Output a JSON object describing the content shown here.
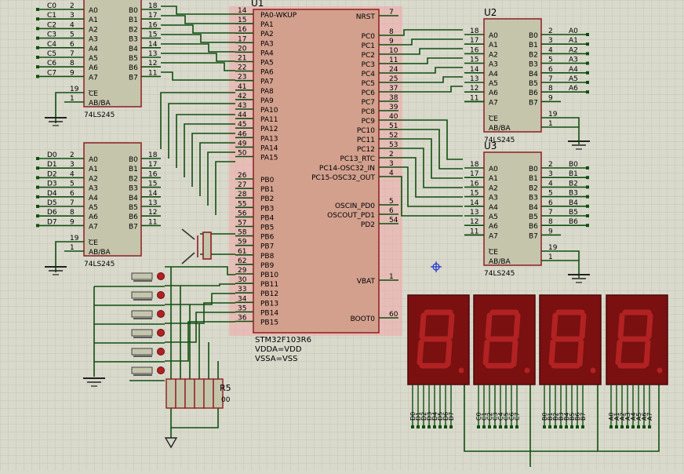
{
  "u1": {
    "ref": "U1",
    "part": "STM32F103R6",
    "props": [
      "VDDA=VDD",
      "VSSA=VSS"
    ],
    "left_pins": [
      {
        "num": "14",
        "name": "PA0-WKUP"
      },
      {
        "num": "15",
        "name": "PA1"
      },
      {
        "num": "16",
        "name": "PA2"
      },
      {
        "num": "17",
        "name": "PA3"
      },
      {
        "num": "20",
        "name": "PA4"
      },
      {
        "num": "21",
        "name": "PA5"
      },
      {
        "num": "22",
        "name": "PA6"
      },
      {
        "num": "23",
        "name": "PA7"
      },
      {
        "num": "41",
        "name": "PA8"
      },
      {
        "num": "42",
        "name": "PA9"
      },
      {
        "num": "43",
        "name": "PA10"
      },
      {
        "num": "44",
        "name": "PA11"
      },
      {
        "num": "45",
        "name": "PA12"
      },
      {
        "num": "46",
        "name": "PA13"
      },
      {
        "num": "49",
        "name": "PA14"
      },
      {
        "num": "50",
        "name": "PA15"
      },
      {
        "num": "26",
        "name": "PB0"
      },
      {
        "num": "27",
        "name": "PB1"
      },
      {
        "num": "28",
        "name": "PB2"
      },
      {
        "num": "55",
        "name": "PB3"
      },
      {
        "num": "56",
        "name": "PB4"
      },
      {
        "num": "57",
        "name": "PB5"
      },
      {
        "num": "58",
        "name": "PB6"
      },
      {
        "num": "59",
        "name": "PB7"
      },
      {
        "num": "61",
        "name": "PB8"
      },
      {
        "num": "62",
        "name": "PB9"
      },
      {
        "num": "29",
        "name": "PB10"
      },
      {
        "num": "30",
        "name": "PB11"
      },
      {
        "num": "33",
        "name": "PB12"
      },
      {
        "num": "34",
        "name": "PB13"
      },
      {
        "num": "35",
        "name": "PB14"
      },
      {
        "num": "36",
        "name": "PB15"
      }
    ],
    "right_pins": [
      {
        "num": "7",
        "name": "NRST"
      },
      {
        "num": "8",
        "name": "PC0"
      },
      {
        "num": "9",
        "name": "PC1"
      },
      {
        "num": "10",
        "name": "PC2"
      },
      {
        "num": "11",
        "name": "PC3"
      },
      {
        "num": "24",
        "name": "PC4"
      },
      {
        "num": "25",
        "name": "PC5"
      },
      {
        "num": "37",
        "name": "PC6"
      },
      {
        "num": "38",
        "name": "PC7"
      },
      {
        "num": "39",
        "name": "PC8"
      },
      {
        "num": "40",
        "name": "PC9"
      },
      {
        "num": "51",
        "name": "PC10"
      },
      {
        "num": "52",
        "name": "PC11"
      },
      {
        "num": "53",
        "name": "PC12"
      },
      {
        "num": "2",
        "name": "PC13_RTC"
      },
      {
        "num": "3",
        "name": "PC14-OSC32_IN"
      },
      {
        "num": "4",
        "name": "PC15-OSC32_OUT"
      },
      {
        "num": "5",
        "name": "OSCIN_PD0"
      },
      {
        "num": "6",
        "name": "OSCOUT_PD1"
      },
      {
        "num": "54",
        "name": "PD2"
      },
      {
        "num": "1",
        "name": "VBAT"
      },
      {
        "num": "60",
        "name": "BOOT0"
      }
    ]
  },
  "buffers": [
    {
      "ref": "",
      "part": "74LS245",
      "nets": [
        "C0",
        "C1",
        "C2",
        "C3",
        "C4",
        "C5",
        "C6",
        "C7"
      ],
      "left_nums": [
        "2",
        "3",
        "4",
        "5",
        "6",
        "7",
        "8",
        "9"
      ],
      "right_nums": [
        "18",
        "17",
        "16",
        "15",
        "14",
        "13",
        "12",
        "11"
      ],
      "a_labels": [
        "A0",
        "A1",
        "A2",
        "A3",
        "A4",
        "A5",
        "A6",
        "A7"
      ],
      "b_labels": [
        "B0",
        "B1",
        "B2",
        "B3",
        "B4",
        "B5",
        "B6",
        "B7"
      ],
      "ce_num": "19",
      "dir_num": "1",
      "ce_label": "CE",
      "dir_label": "AB/BA"
    },
    {
      "ref": "",
      "part": "74LS245",
      "nets": [
        "D0",
        "D1",
        "D2",
        "D3",
        "D4",
        "D5",
        "D6",
        "D7"
      ],
      "left_nums": [
        "2",
        "3",
        "4",
        "5",
        "6",
        "7",
        "8",
        "9"
      ],
      "right_nums": [
        "18",
        "17",
        "16",
        "15",
        "14",
        "13",
        "12",
        "11"
      ],
      "a_labels": [
        "A0",
        "A1",
        "A2",
        "A3",
        "A4",
        "A5",
        "A6",
        "A7"
      ],
      "b_labels": [
        "B0",
        "B1",
        "B2",
        "B3",
        "B4",
        "B5",
        "B6",
        "B7"
      ],
      "ce_num": "19",
      "dir_num": "1",
      "ce_label": "CE",
      "dir_label": "AB/BA"
    },
    {
      "ref": "U2",
      "part": "74LS245",
      "nets": [
        "A0",
        "A1",
        "A2",
        "A3",
        "A4",
        "A5",
        "A6"
      ],
      "left_nums": [
        "18",
        "17",
        "16",
        "15",
        "14",
        "13",
        "12",
        "11"
      ],
      "right_nums": [
        "2",
        "3",
        "4",
        "5",
        "6",
        "7",
        "8",
        "9"
      ],
      "a_labels": [
        "A0",
        "A1",
        "A2",
        "A3",
        "A4",
        "A5",
        "A6",
        "A7"
      ],
      "b_labels": [
        "B0",
        "B1",
        "B2",
        "B3",
        "B4",
        "B5",
        "B6",
        "B7"
      ],
      "ce_num": "19",
      "dir_num": "1",
      "ce_label": "CE",
      "dir_label": "AB/BA"
    },
    {
      "ref": "U3",
      "part": "74LS245",
      "nets": [
        "B0",
        "B1",
        "B2",
        "B3",
        "B4",
        "B5",
        "B6"
      ],
      "left_nums": [
        "18",
        "17",
        "16",
        "15",
        "14",
        "13",
        "12",
        "11"
      ],
      "right_nums": [
        "2",
        "3",
        "4",
        "5",
        "6",
        "7",
        "8",
        "9"
      ],
      "a_labels": [
        "A0",
        "A1",
        "A2",
        "A3",
        "A4",
        "A5",
        "A6",
        "A7"
      ],
      "b_labels": [
        "B0",
        "B1",
        "B2",
        "B3",
        "B4",
        "B5",
        "B6",
        "B7"
      ],
      "ce_num": "19",
      "dir_num": "1",
      "ce_label": "CE",
      "dir_label": "AB/BA"
    }
  ],
  "resistor": {
    "ref": "R5",
    "value": "00"
  },
  "displays": [
    {
      "pin_labels": [
        "D0",
        "D1",
        "D2",
        "D3",
        "D4",
        "D5",
        "D6",
        "D7"
      ]
    },
    {
      "pin_labels": [
        "C0",
        "C1",
        "C2",
        "C3",
        "C4",
        "C5",
        "C6",
        "C7"
      ]
    },
    {
      "pin_labels": [
        "B0",
        "B1",
        "B2",
        "B3",
        "B4",
        "B5",
        "B6",
        "B7"
      ]
    },
    {
      "pin_labels": [
        "A0",
        "A1",
        "A2",
        "A3",
        "A4",
        "A5",
        "A6",
        "A7"
      ]
    }
  ],
  "colors": {
    "background": "#d9d9cc",
    "grid": "#c6c6b7",
    "wire": "#0f4f0f",
    "wire_accent": "#2aa02a",
    "chip_fill": "#c5c5ac",
    "chip_edge": "#8c1f1f",
    "mcu_fill": "#d3a08e",
    "mcu_highlight": "#f1a6a6",
    "display_body": "#7a1010",
    "segment": "#b22222",
    "marker": "#1a2fd0",
    "text": "#000000"
  }
}
